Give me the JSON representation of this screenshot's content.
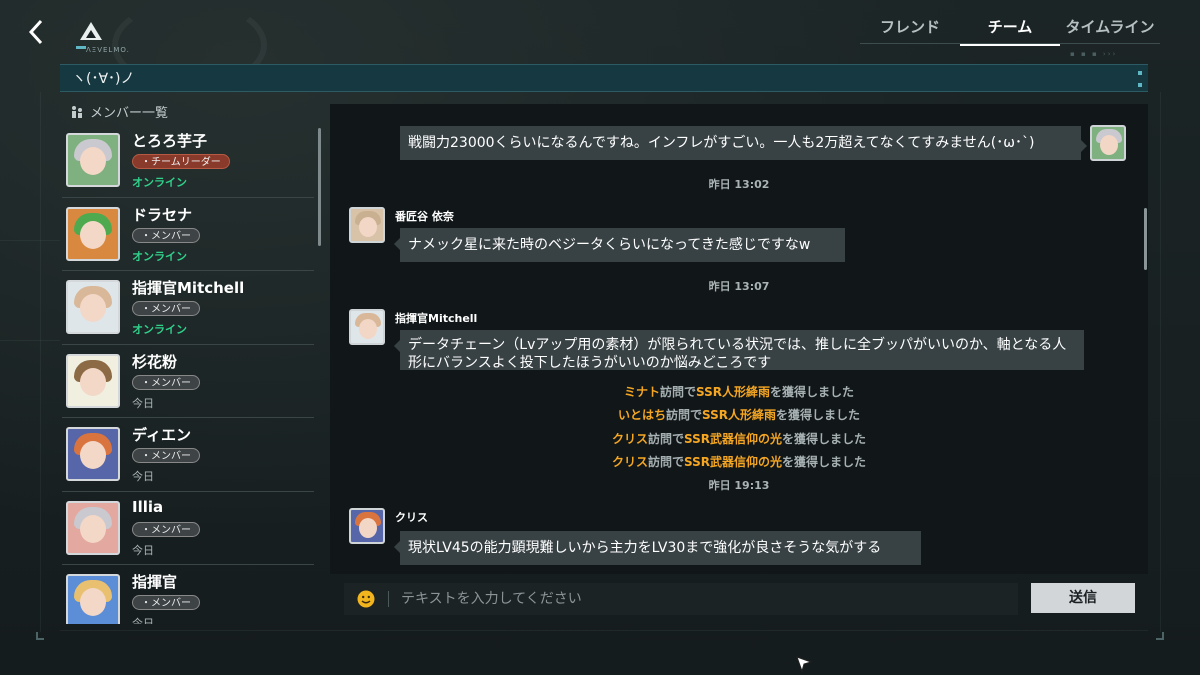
{
  "header": {
    "logo_text": "ΛΞVELMO.",
    "tabs": [
      {
        "label": "フレンド",
        "active": false
      },
      {
        "label": "チーム",
        "active": true
      },
      {
        "label": "タイムライン",
        "active": false
      }
    ]
  },
  "status_bar": {
    "text": "ヽ(･∀･)ノ"
  },
  "members": {
    "header": "メンバー一覧",
    "items": [
      {
        "name": "とろろ芋子",
        "role": "・チームリーダー",
        "status": "オンライン",
        "online": true,
        "hair": "#c9c9cf",
        "bg": "#7fb07f"
      },
      {
        "name": "ドラセナ",
        "role": "・メンバー",
        "status": "オンライン",
        "online": true,
        "hair": "#4faa4f",
        "bg": "#d9893f"
      },
      {
        "name": "指揮官Mitchell",
        "role": "・メンバー",
        "status": "オンライン",
        "online": true,
        "hair": "#d9b89a",
        "bg": "#dfe6ea"
      },
      {
        "name": "杉花粉",
        "role": "・メンバー",
        "status": "今日",
        "online": false,
        "hair": "#8b6a45",
        "bg": "#f0efe0"
      },
      {
        "name": "ディエン",
        "role": "・メンバー",
        "status": "今日",
        "online": false,
        "hair": "#d9743f",
        "bg": "#5766a8"
      },
      {
        "name": "Illia",
        "role": "・メンバー",
        "status": "今日",
        "online": false,
        "hair": "#c9c9cf",
        "bg": "#e3a8a0"
      },
      {
        "name": "指揮官",
        "role": "・メンバー",
        "status": "今日",
        "online": false,
        "hair": "#e8c070",
        "bg": "#5b8ed6"
      }
    ]
  },
  "chat": {
    "messages": [
      {
        "id": "m1",
        "sender": "",
        "mine": true,
        "text": "戦闘力23000くらいになるんですね。インフレがすごい。一人も2万超えてなくてすみません(･ω･`)"
      },
      {
        "id": "m2",
        "sender": "番匠谷 依奈",
        "mine": false,
        "text": "ナメック星に来た時のベジータくらいになってきた感じですなw"
      },
      {
        "id": "m3",
        "sender": "指揮官Mitchell",
        "mine": false,
        "text": "データチェーン（Lvアップ用の素材）が限られている状況では、推しに全ブッパがいいのか、軸となる人形にバランスよく投下したほうがいいのか悩みどころです"
      },
      {
        "id": "m4",
        "sender": "クリス",
        "mine": false,
        "text": "現状LV45の能力顕現難しいから主力をLV30まで強化が良さそうな気がする"
      }
    ],
    "timestamps": [
      "昨日 13:02",
      "昨日 13:07",
      "昨日 19:13"
    ],
    "system": [
      {
        "name": "ミナト",
        "mid": "訪問で",
        "item": "SSR人形絳雨",
        "end": "を獲得しました"
      },
      {
        "name": "いとはち",
        "mid": "訪問で",
        "item": "SSR人形絳雨",
        "end": "を獲得しました"
      },
      {
        "name": "クリス",
        "mid": "訪問で",
        "item": "SSR武器信仰の光",
        "end": "を獲得しました"
      },
      {
        "name": "クリス",
        "mid": "訪問で",
        "item": "SSR武器信仰の光",
        "end": "を獲得しました"
      }
    ]
  },
  "input": {
    "placeholder": "テキストを入力してください",
    "value": ""
  },
  "send_label": "送信",
  "icons": [
    "back-arrow-icon",
    "logo-icon",
    "members-icon",
    "emoji-icon",
    "cursor-icon"
  ],
  "colors": {
    "accent_orange": "#f5a623",
    "online_green": "#2fd18b",
    "leader_badge": "#8a3a2a",
    "status_bar": "#163840"
  }
}
